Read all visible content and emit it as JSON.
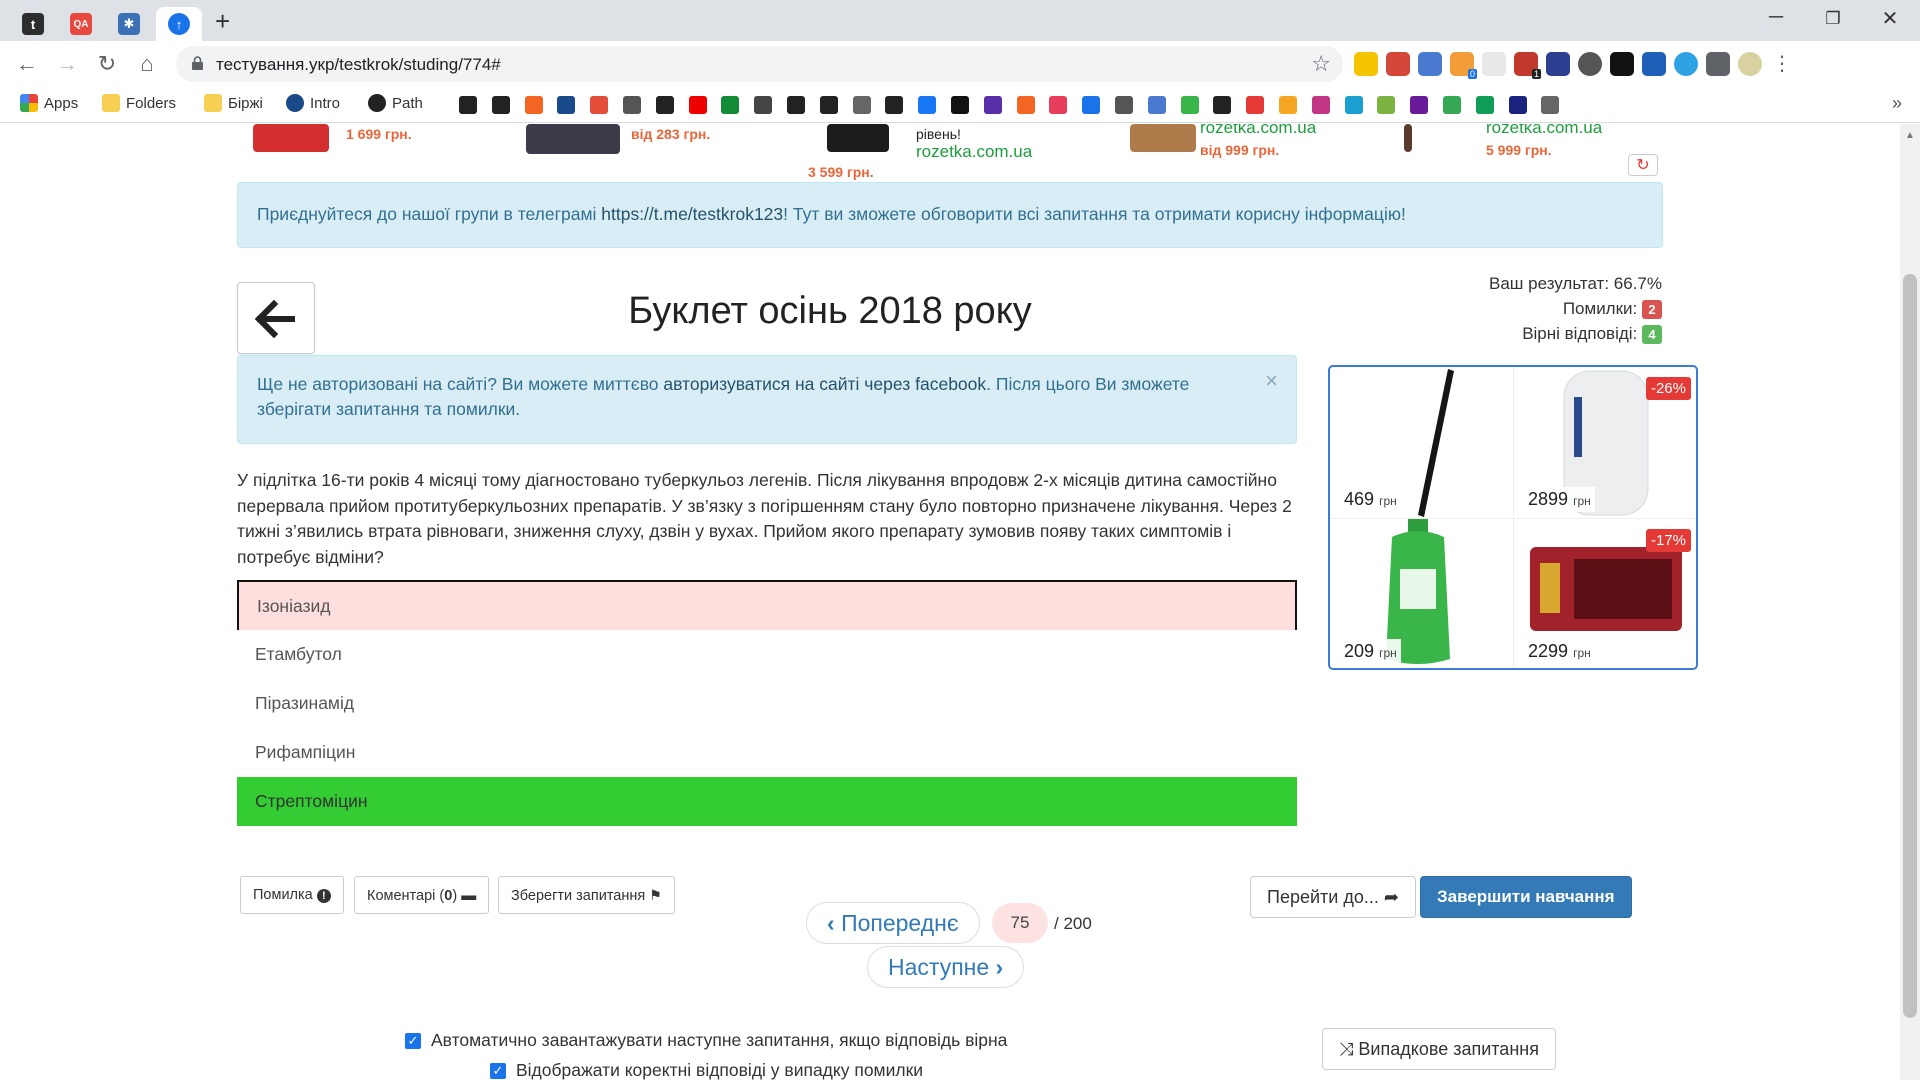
{
  "browser": {
    "url": "тестування.укр/testkrok/studing/774#",
    "tabs": [
      {
        "label": "t",
        "color": "#333333"
      },
      {
        "label": "QA",
        "color": "#e8493f"
      },
      {
        "label": "✱",
        "color": "#3b6fb6"
      },
      {
        "label": "↑",
        "color": "#1a73e8"
      }
    ],
    "bookmarks": [
      {
        "label": "Apps",
        "icon": "apps-grid-icon"
      },
      {
        "label": "Folders",
        "icon": "folder-icon"
      },
      {
        "label": "Біржі",
        "icon": "folder-icon"
      },
      {
        "label": "Intro",
        "icon": "react-icon"
      },
      {
        "label": "Path",
        "icon": "github-icon"
      }
    ],
    "extension_badge": "1",
    "extension_badge2": "0"
  },
  "top_ads": {
    "ad1_price": "1 699 грн.",
    "ad2_price": "від 283 грн.",
    "ad3_price": "3 599 грн.",
    "ad3_text": "рівень!",
    "ad3_site": "rozetka.com.ua",
    "ad4_site": "rozetka.com.ua",
    "ad4_price": "від 999 грн.",
    "ad5_site": "rozetka.com.ua",
    "ad5_price": "5 999 грн."
  },
  "telegram_alert": {
    "text_before": "Приєднуйтеся до нашої групи в телеграмі ",
    "link": "https://t.me/testkrok123",
    "text_after": "! Тут ви зможете обговорити всі запитання та отримати корисну інформацію!"
  },
  "page_title": "Буклет осінь 2018 року",
  "results": {
    "score_label": "Ваш результат: 66.7%",
    "mistakes_label": "Помилки:",
    "mistakes_count": "2",
    "correct_label": "Вірні відповіді:",
    "correct_count": "4"
  },
  "auth_alert": {
    "text1": "Ще не авторизовані на сайті? Ви можете миттєво ",
    "link": "авторизуватися на сайті через facebook",
    "text2": ". Після цього Ви зможете зберігати запитання та помилки.",
    "close": "×"
  },
  "question": "У підлітка 16-ти років 4 місяці тому діагностовано туберкульоз легенів. Після лікування впродовж 2-х місяців дитина самостійно перервала прийом протитуберкульозних препаратів. У зв’язку з погіршенням стану було повторно призначене лікування. Через 2 тижні з’явились втрата рівноваги, зниження слуху, дзвін у вухах. Прийом якого препарату зумовив появу таких симптомів і потребує відміни?",
  "answers": [
    {
      "text": "Ізоніазид",
      "state": "wrong"
    },
    {
      "text": "Етамбутол",
      "state": "neutral"
    },
    {
      "text": "Піразинамід",
      "state": "neutral"
    },
    {
      "text": "Рифампіцин",
      "state": "neutral"
    },
    {
      "text": "Стрептоміцин",
      "state": "correct"
    }
  ],
  "shop": {
    "items": [
      {
        "price": "469",
        "currency": "грн",
        "discount": ""
      },
      {
        "price": "2899",
        "currency": "грн",
        "discount": "-26%"
      },
      {
        "price": "209",
        "currency": "грн",
        "discount": ""
      },
      {
        "price": "2299",
        "currency": "грн",
        "discount": "-17%"
      }
    ]
  },
  "actions": {
    "report": "Помилка",
    "comments": "Коментарі (",
    "comments_count": "0",
    "comments_close": ")",
    "save": "Зберегти запитання",
    "goto": "Перейти до...",
    "finish": "Завершити навчання",
    "prev": "Попереднє",
    "next": "Наступне",
    "current_page": "75",
    "total_pages": "/ 200",
    "random": "Випадкове запитання"
  },
  "options": {
    "auto_next": "Автоматично завантажувати наступне запитання, якщо відповідь вірна",
    "show_correct": "Відображати коректні відповіді у випадку помилки"
  }
}
